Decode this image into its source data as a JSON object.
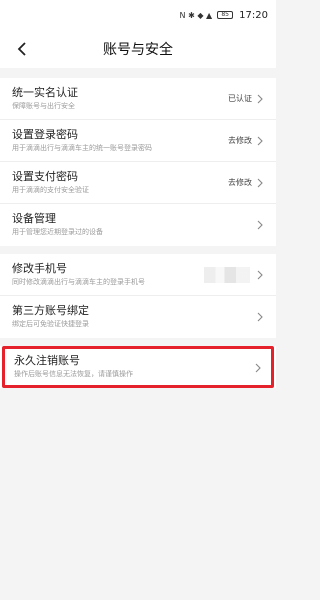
{
  "statusbar": {
    "icons": "N ✱ ◆ ▲",
    "battery": "85",
    "time": "17:20"
  },
  "navbar": {
    "title": "账号与安全"
  },
  "sections": [
    {
      "rows": [
        {
          "label": "统一实名认证",
          "sub": "保障账号与出行安全",
          "status": "已认证"
        },
        {
          "label": "设置登录密码",
          "sub": "用于滴滴出行与滴滴车主的统一账号登录密码",
          "status": "去修改"
        },
        {
          "label": "设置支付密码",
          "sub": "用于滴滴的支付安全验证",
          "status": "去修改"
        },
        {
          "label": "设备管理",
          "sub": "用于管理您近期登录过的设备",
          "status": ""
        }
      ]
    },
    {
      "rows": [
        {
          "label": "修改手机号",
          "sub": "同时修改滴滴出行与滴滴车主的登录手机号",
          "status": ""
        },
        {
          "label": "第三方账号绑定",
          "sub": "绑定后可免验证快捷登录",
          "status": ""
        }
      ]
    }
  ],
  "danger": {
    "label": "永久注销账号",
    "sub": "操作后账号信息无法恢复，请谨慎操作"
  },
  "colors": {
    "highlight": "#e5222b",
    "background": "#f4f4f4"
  }
}
